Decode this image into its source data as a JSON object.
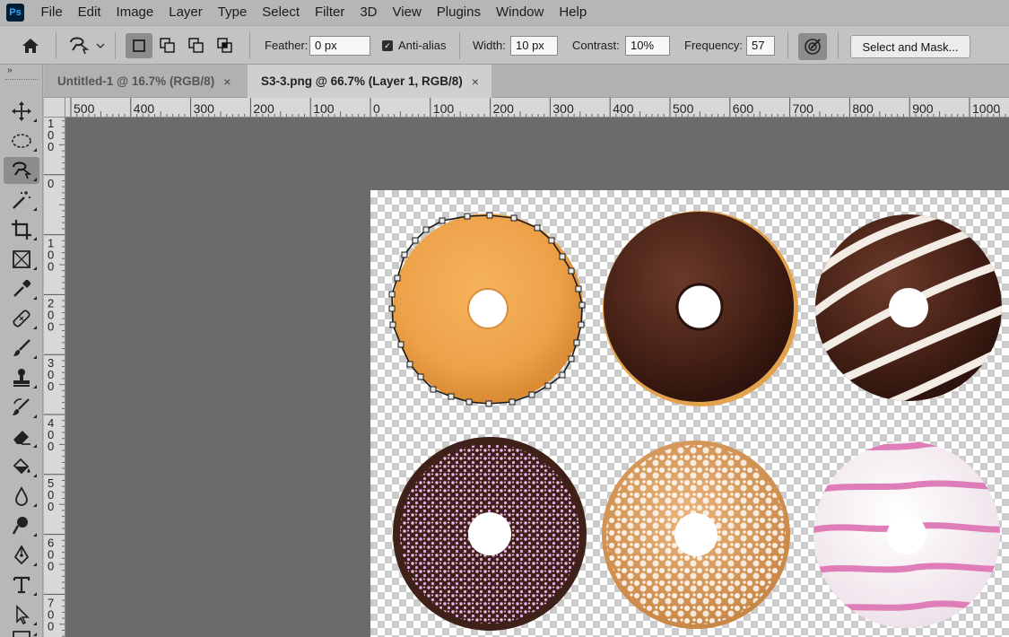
{
  "app": {
    "logo": "Ps"
  },
  "menu": [
    "File",
    "Edit",
    "Image",
    "Layer",
    "Type",
    "Select",
    "Filter",
    "3D",
    "View",
    "Plugins",
    "Window",
    "Help"
  ],
  "options": {
    "feather_label": "Feather:",
    "feather_value": "0 px",
    "antialias_label": "Anti-alias",
    "antialias_checked": true,
    "width_label": "Width:",
    "width_value": "10 px",
    "contrast_label": "Contrast:",
    "contrast_value": "10%",
    "frequency_label": "Frequency:",
    "frequency_value": "57",
    "select_mask_label": "Select and Mask..."
  },
  "toolbar": {
    "grip": "»",
    "tools": [
      "move-tool",
      "marquee-tool",
      "magnetic-lasso-tool",
      "magic-wand-tool",
      "crop-tool",
      "frame-tool",
      "eyedropper-tool",
      "healing-brush-tool",
      "brush-tool",
      "clone-stamp-tool",
      "history-brush-tool",
      "eraser-tool",
      "paint-bucket-tool",
      "blur-tool",
      "dodge-tool",
      "pen-tool",
      "type-tool",
      "path-selection-tool",
      "rectangle-tool"
    ],
    "selected": "magnetic-lasso-tool"
  },
  "tabs": [
    {
      "title": "Untitled-1 @ 16.7% (RGB/8)",
      "close": "×",
      "active": false
    },
    {
      "title": "S3-3.png @ 66.7% (Layer 1, RGB/8)",
      "close": "×",
      "active": true
    }
  ],
  "ruler_top": [
    "500",
    "400",
    "300",
    "200",
    "100",
    "0",
    "100",
    "200",
    "300",
    "400",
    "500",
    "600",
    "700",
    "800",
    "900",
    "1000"
  ],
  "ruler_left": [
    "100",
    "0",
    "100",
    "200",
    "300",
    "400",
    "500",
    "600",
    "700"
  ],
  "colors": {
    "accent_ps": "#31a8ff",
    "workspace": "#6b6b6b",
    "ui_bg": "#b6b6b6"
  }
}
